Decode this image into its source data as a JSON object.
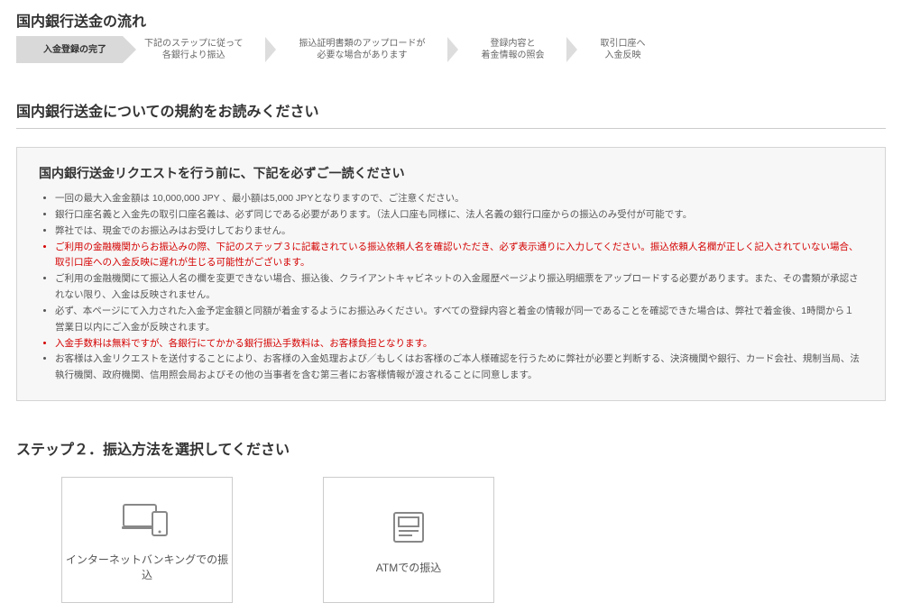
{
  "flowTitle": "国内銀行送金の流れ",
  "steps": [
    "入金登録の完了",
    "下記のステップに従って\n各銀行より振込",
    "振込証明書類のアップロードが\n必要な場合があります",
    "登録内容と\n着金情報の照会",
    "取引口座へ\n入金反映"
  ],
  "termsTitle": "国内銀行送金についての規約をお読みください",
  "termsSubTitle": "国内銀行送金リクエストを行う前に、下記を必ずご一読ください",
  "termsItems": [
    {
      "text": "一回の最大入金金額は 10,000,000 JPY 、最小額は5,000 JPYとなりますので、ご注意ください。",
      "red": false
    },
    {
      "text": "銀行口座名義と入金先の取引口座名義は、必ず同じである必要があります。（法人口座も同様に、法人名義の銀行口座からの振込のみ受付が可能です。",
      "red": false
    },
    {
      "text": "弊社では、現金でのお振込みはお受けしておりません。",
      "red": false
    },
    {
      "text": "ご利用の金融機関からお振込みの際、下記のステップ３に記載されている振込依頼人名を確認いただき、必ず表示通りに入力してください。振込依頼人名欄が正しく記入されていない場合、取引口座への入金反映に遅れが生じる可能性がございます。",
      "red": true
    },
    {
      "text": "ご利用の金融機関にて振込人名の欄を変更できない場合、振込後、クライアントキャビネットの入金履歴ページより振込明細票をアップロードする必要があります。また、その書類が承認されない限り、入金は反映されません。",
      "red": false
    },
    {
      "text": "必ず、本ページにて入力された入金予定金額と同額が着金するようにお振込みください。すべての登録内容と着金の情報が同一であることを確認できた場合は、弊社で着金後、1時間から１営業日以内にご入金が反映されます。",
      "red": false
    },
    {
      "text": "入金手数料は無料ですが、各銀行にてかかる銀行振込手数料は、お客様負担となります。",
      "red": true
    },
    {
      "text": "お客様は入金リクエストを送付することにより、お客様の入金処理および／もしくはお客様のご本人様確認を行うために弊社が必要と判断する、決済機関や銀行、カード会社、規制当局、法執行機関、政府機関、信用照会局およびその他の当事者を含む第三者にお客様情報が渡されることに同意します。",
      "red": false
    }
  ],
  "stepSelectTitle": "ステップ２．振込方法を選択してください",
  "options": {
    "internet": "インターネットバンキングでの振込",
    "atm": "ATMでの振込"
  }
}
